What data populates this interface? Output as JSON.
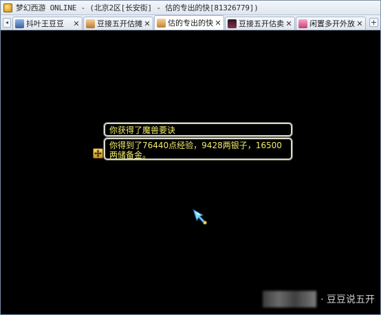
{
  "window": {
    "title": "梦幻西游 ONLINE - (北京2区[长安街] - 估的专出的快[81326779])"
  },
  "tabs": [
    {
      "label": "抖叶王豆豆",
      "avatar_color": "#4f7fc4",
      "active": false
    },
    {
      "label": "豆接五开估摊",
      "avatar_color": "#d8a15a",
      "active": false
    },
    {
      "label": "估的专出的快",
      "avatar_color": "#e3a75c",
      "active": true
    },
    {
      "label": "豆接五开估卖",
      "avatar_color": "#7a2a3a",
      "active": false
    },
    {
      "label": "闲置多开外放",
      "avatar_color": "#d45a8a",
      "active": false
    }
  ],
  "tabbar": {
    "scroll_left": "◂",
    "close_symbol": "✕",
    "add_symbol": "+"
  },
  "messages": {
    "line1": "你获得了魔兽要诀",
    "line2": "你得到了76440点经验，9428两银子，16500两储备金。"
  },
  "watermark": {
    "text": "· 豆豆说五开"
  }
}
